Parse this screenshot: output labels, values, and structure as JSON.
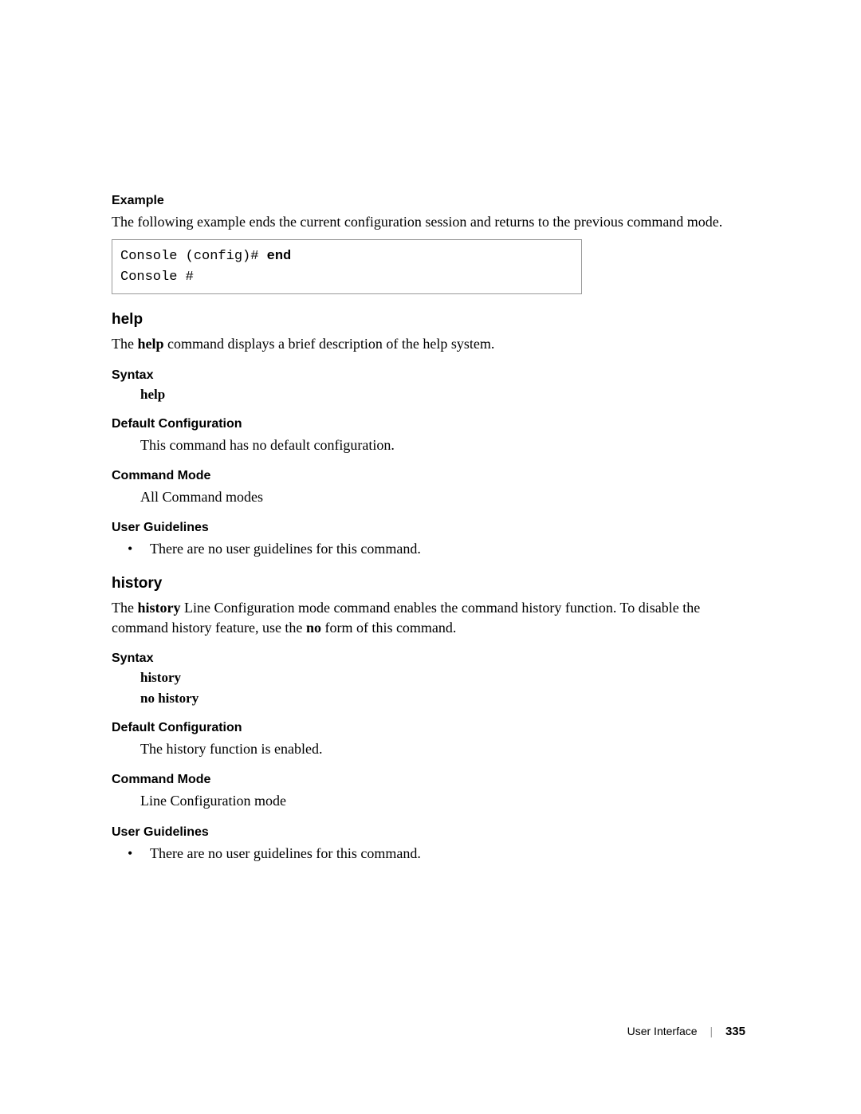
{
  "example": {
    "heading": "Example",
    "description": "The following example ends the current configuration session and returns to the previous command mode.",
    "code_prefix": "Console (config)# ",
    "code_cmd": "end",
    "code_line2": "Console #"
  },
  "help": {
    "heading": "help",
    "intro_pre": "The ",
    "intro_bold": "help",
    "intro_post": " command displays a brief description of the help system.",
    "syntax_heading": "Syntax",
    "syntax_item": "help",
    "default_heading": "Default Configuration",
    "default_text": "This command has no default configuration.",
    "mode_heading": "Command Mode",
    "mode_text": "All Command modes",
    "guidelines_heading": "User Guidelines",
    "guidelines_bullet": "There are no user guidelines for this command."
  },
  "history": {
    "heading": "history",
    "intro_pre": "The ",
    "intro_bold1": "history",
    "intro_mid": " Line Configuration mode command enables the command history function. To disable the command history feature, use the ",
    "intro_bold2": "no",
    "intro_post": " form of this command.",
    "syntax_heading": "Syntax",
    "syntax_item1": "history",
    "syntax_item2": "no history",
    "default_heading": "Default Configuration",
    "default_text": "The history function is enabled.",
    "mode_heading": "Command Mode",
    "mode_text": "Line Configuration mode",
    "guidelines_heading": "User Guidelines",
    "guidelines_bullet": "There are no user guidelines for this command."
  },
  "footer": {
    "section": "User Interface",
    "page": "335"
  }
}
